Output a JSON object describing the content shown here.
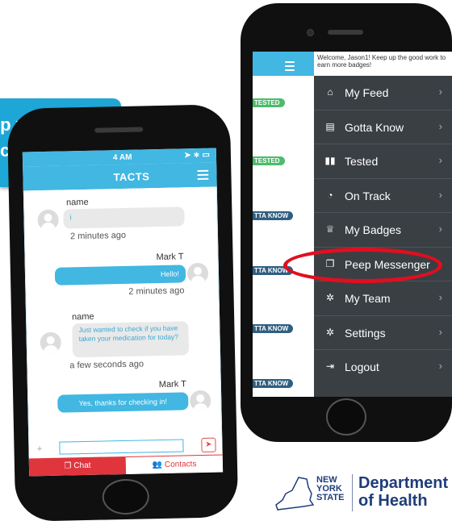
{
  "callout": {
    "line1": "lp you",
    "line2": "care"
  },
  "left_phone": {
    "status_time": "4 AM",
    "status_icons": "➤ ∗ ▭",
    "header_title": "TACTS",
    "messages": [
      {
        "name": "name",
        "text": "i",
        "time": "2 minutes ago",
        "direction": "in"
      },
      {
        "name": "Mark T",
        "text": "Hello!",
        "time": "2 minutes ago",
        "direction": "out"
      },
      {
        "name": "name",
        "text": "Just wanted to check if you have taken your medication for today?",
        "time": "a few seconds ago",
        "direction": "in"
      },
      {
        "name": "Mark T",
        "text": "Yes, thanks for checking in!",
        "time": "",
        "direction": "out"
      }
    ],
    "composer": {
      "plus": "+",
      "value": "",
      "send_icon": "➤"
    },
    "tabs": [
      {
        "label": "Chat",
        "icon": "chat-icon"
      },
      {
        "label": "Contacts",
        "icon": "contacts-icon"
      }
    ]
  },
  "right_phone": {
    "welcome_text": "Welcome, Jason1! Keep up the good work to earn more badges!",
    "background_tags": [
      "TESTED",
      "TESTED",
      "TTA KNOW",
      "TTA KNOW",
      "TTA KNOW",
      "TTA KNOW"
    ],
    "menu": [
      {
        "label": "My Feed",
        "icon": "home-icon",
        "glyph": "⌂"
      },
      {
        "label": "Gotta Know",
        "icon": "document-icon",
        "glyph": "▤"
      },
      {
        "label": "Tested",
        "icon": "book-icon",
        "glyph": "▮▮"
      },
      {
        "label": "On Track",
        "icon": "clock-icon",
        "glyph": "◔"
      },
      {
        "label": "My Badges",
        "icon": "badge-icon",
        "glyph": "♕"
      },
      {
        "label": "Peep Messenger",
        "icon": "messenger-icon",
        "glyph": "❐"
      },
      {
        "label": "My Team",
        "icon": "team-icon",
        "glyph": "✲"
      },
      {
        "label": "Settings",
        "icon": "gear-icon",
        "glyph": "✲"
      },
      {
        "label": "Logout",
        "icon": "logout-icon",
        "glyph": "⇥"
      }
    ],
    "chevron": "›"
  },
  "logo": {
    "state_line1": "NEW",
    "state_line2": "YORK",
    "state_line3": "STATE",
    "dept_line1": "Department",
    "dept_line2": "of Health"
  },
  "colors": {
    "app_blue": "#41b7e2",
    "menu_bg": "#3a3f44",
    "highlight_red": "#e00f1f",
    "tab_red": "#e0353d",
    "nys_blue": "#1f3d7a"
  }
}
